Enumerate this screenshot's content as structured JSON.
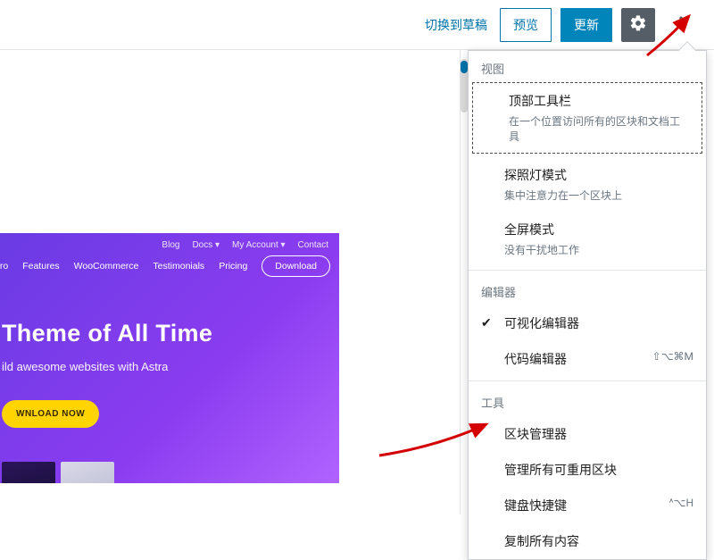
{
  "toolbar": {
    "switch_to_draft": "切换到草稿",
    "preview": "预览",
    "update": "更新"
  },
  "menu": {
    "section_view": "视图",
    "top_toolbar": {
      "title": "顶部工具栏",
      "desc": "在一个位置访问所有的区块和文档工具"
    },
    "spotlight": {
      "title": "探照灯模式",
      "desc": "集中注意力在一个区块上"
    },
    "fullscreen": {
      "title": "全屏模式",
      "desc": "没有干扰地工作"
    },
    "section_editor": "编辑器",
    "visual_editor": "可视化编辑器",
    "code_editor": "代码编辑器",
    "code_editor_shortcut": "⇧⌥⌘M",
    "section_tools": "工具",
    "block_manager": "区块管理器",
    "manage_reusable": "管理所有可重用区块",
    "keyboard_shortcuts": "键盘快捷键",
    "keyboard_shortcuts_shortcut": "^⌥H",
    "copy_all": "复制所有内容"
  },
  "hero": {
    "top_nav": [
      "Blog",
      "Docs ▾",
      "My Account ▾",
      "Contact"
    ],
    "primary_nav": [
      "Pro",
      "Features",
      "WooCommerce",
      "Testimonials",
      "Pricing"
    ],
    "download": "Download",
    "title": "Theme of All Time",
    "subtitle": "ild awesome websites with Astra",
    "cta": "WNLOAD NOW"
  }
}
